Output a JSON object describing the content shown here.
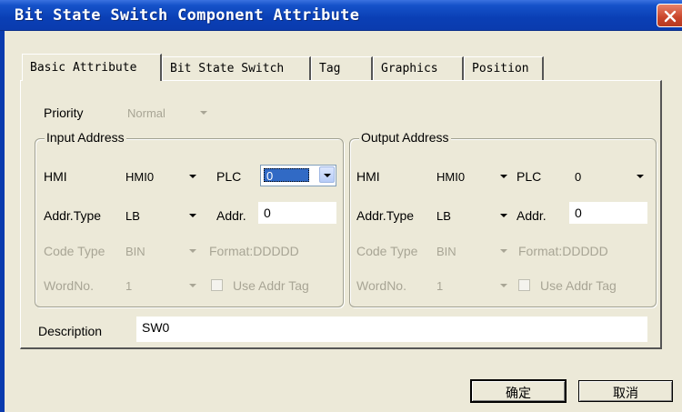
{
  "window": {
    "title": "Bit State Switch Component Attribute"
  },
  "tabs": [
    "Basic Attribute",
    "Bit State Switch",
    "Tag",
    "Graphics",
    "Position"
  ],
  "priority": {
    "label": "Priority",
    "value": "Normal"
  },
  "input_address": {
    "title": "Input Address",
    "hmi_label": "HMI",
    "hmi_value": "HMI0",
    "plc_label": "PLC",
    "plc_value": "0",
    "addr_type_label": "Addr.Type",
    "addr_type_value": "LB",
    "addr_label": "Addr.",
    "addr_value": "0",
    "code_type_label": "Code Type",
    "code_type_value": "BIN",
    "format_text": "Format:DDDDD",
    "word_no_label": "WordNo.",
    "word_no_value": "1",
    "use_addr_tag_label": "Use Addr Tag"
  },
  "output_address": {
    "title": "Output Address",
    "hmi_label": "HMI",
    "hmi_value": "HMI0",
    "plc_label": "PLC",
    "plc_value": "0",
    "addr_type_label": "Addr.Type",
    "addr_type_value": "LB",
    "addr_label": "Addr.",
    "addr_value": "0",
    "code_type_label": "Code Type",
    "code_type_value": "BIN",
    "format_text": "Format:DDDDD",
    "word_no_label": "WordNo.",
    "word_no_value": "1",
    "use_addr_tag_label": "Use Addr Tag"
  },
  "description": {
    "label": "Description",
    "value": "SW0"
  },
  "buttons": {
    "ok": "确定",
    "cancel": "取消"
  },
  "colors": {
    "titlebar": "#0a3fb5",
    "close": "#c9452b",
    "dialog_bg": "#ece9d8",
    "selection": "#316ac5"
  },
  "icons": {
    "close": "close-icon",
    "dropdown": "chevron-down-icon"
  }
}
